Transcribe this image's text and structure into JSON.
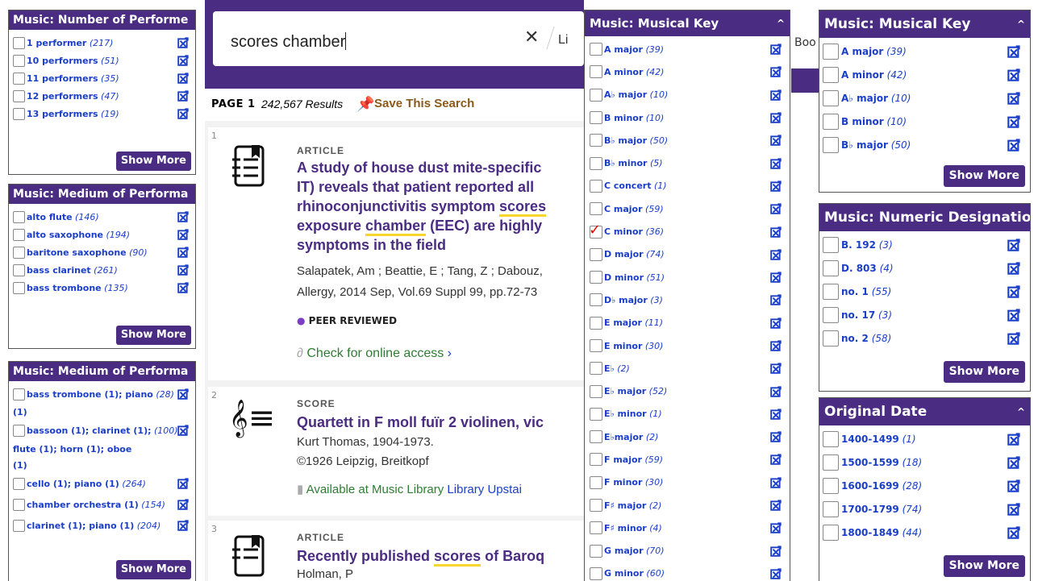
{
  "search": {
    "query": "scores chamber",
    "clear_label": "✕",
    "limit_label_partial": "Li",
    "books_partial": "Boo"
  },
  "results_header": {
    "page_label": "PAGE 1",
    "count": "242,567 Results",
    "save_label": "Save This Search"
  },
  "results": [
    {
      "num": "1",
      "type": "ARTICLE",
      "title_lines": [
        "A study of house dust mite-specific",
        "IT) reveals that patient reported all",
        "rhinoconjunctivitis symptom scores",
        "exposure chamber (EEC) are highly",
        "symptoms in the field"
      ],
      "authors": "Salapatek, Am ; Beattie, E ; Tang, Z ; Dabouz,",
      "source": "Allergy, 2014 Sep, Vol.69 Suppl 99, pp.72-73",
      "peer_reviewed": "PEER REVIEWED",
      "online": "Check for online access"
    },
    {
      "num": "2",
      "type": "SCORE",
      "title": "Quartett in F moll fuïr 2 violinen, vic",
      "author": "Kurt Thomas, 1904-1973.",
      "pub": "©1926 Leipzig, Breitkopf",
      "avail": "Available at Music Library",
      "location": "Library Upstai"
    },
    {
      "num": "3",
      "type": "ARTICLE",
      "title_pre": "Recently published ",
      "title_hl": "scores",
      "title_post": " of Baroq",
      "author": "Holman, P"
    }
  ],
  "facets": {
    "performers": {
      "title": "Music: Number of Performe",
      "items": [
        {
          "label": "1 performer",
          "count": "(217)"
        },
        {
          "label": "10 performers",
          "count": "(51)"
        },
        {
          "label": "11 performers",
          "count": "(35)"
        },
        {
          "label": "12 performers",
          "count": "(47)"
        },
        {
          "label": "13 performers",
          "count": "(19)"
        }
      ],
      "show_more": "Show More"
    },
    "medium1": {
      "title": "Music: Medium of Performa",
      "items": [
        {
          "label": "alto flute",
          "count": "(146)"
        },
        {
          "label": "alto saxophone",
          "count": "(194)"
        },
        {
          "label": "baritone saxophone",
          "count": "(90)"
        },
        {
          "label": "bass clarinet",
          "count": "(261)"
        },
        {
          "label": "bass trombone",
          "count": "(135)"
        }
      ],
      "show_more": "Show More"
    },
    "medium2": {
      "title": "Music: Medium of Performa",
      "items": [
        {
          "label": "bass trombone (1); piano",
          "count": "(28)",
          "cont": "(1)"
        },
        {
          "label": "bassoon (1); clarinet (1);",
          "count": "(100)",
          "cont": "flute (1); horn (1); oboe",
          "cont2": "(1)"
        },
        {
          "label": "cello (1); piano (1)",
          "count": "(264)"
        },
        {
          "label": "chamber orchestra (1)",
          "count": "(154)"
        },
        {
          "label": "clarinet (1); piano (1)",
          "count": "(204)"
        }
      ],
      "show_more": "Show More"
    },
    "key_full": {
      "title": "Music: Musical Key",
      "caret": "^",
      "items": [
        {
          "label": "A major",
          "count": "(39)"
        },
        {
          "label": "A minor",
          "count": "(42)"
        },
        {
          "label": "A♭ major",
          "count": "(10)"
        },
        {
          "label": "B minor",
          "count": "(10)"
        },
        {
          "label": "B♭ major",
          "count": "(50)"
        },
        {
          "label": "B♭ minor",
          "count": "(5)"
        },
        {
          "label": "C concert",
          "count": "(1)"
        },
        {
          "label": "C major",
          "count": "(59)"
        },
        {
          "label": "C minor",
          "count": "(36)",
          "checked": true
        },
        {
          "label": "D major",
          "count": "(74)"
        },
        {
          "label": "D minor",
          "count": "(51)"
        },
        {
          "label": "D♭ major",
          "count": "(3)"
        },
        {
          "label": "E major",
          "count": "(11)"
        },
        {
          "label": "E minor",
          "count": "(30)"
        },
        {
          "label": "E♭",
          "count": "(2)"
        },
        {
          "label": "E♭ major",
          "count": "(52)"
        },
        {
          "label": "E♭ minor",
          "count": "(1)"
        },
        {
          "label": "E♭major",
          "count": "(2)"
        },
        {
          "label": "F major",
          "count": "(59)"
        },
        {
          "label": "F minor",
          "count": "(30)"
        },
        {
          "label": "F♯ major",
          "count": "(2)"
        },
        {
          "label": "F♯ minor",
          "count": "(4)"
        },
        {
          "label": "G major",
          "count": "(70)"
        },
        {
          "label": "G minor",
          "count": "(60)"
        }
      ]
    },
    "key_short": {
      "title": "Music: Musical Key",
      "caret": "^",
      "items": [
        {
          "label": "A major",
          "count": "(39)"
        },
        {
          "label": "A minor",
          "count": "(42)"
        },
        {
          "label": "A♭ major",
          "count": "(10)"
        },
        {
          "label": "B minor",
          "count": "(10)"
        },
        {
          "label": "B♭ major",
          "count": "(50)"
        }
      ],
      "show_more": "Show More"
    },
    "numeric": {
      "title": "Music: Numeric Designation",
      "items": [
        {
          "label": "B. 192",
          "count": "(3)"
        },
        {
          "label": "D. 803",
          "count": "(4)"
        },
        {
          "label": "no. 1",
          "count": "(55)"
        },
        {
          "label": "no. 17",
          "count": "(3)"
        },
        {
          "label": "no. 2",
          "count": "(58)"
        }
      ],
      "show_more": "Show More"
    },
    "date": {
      "title": "Original Date",
      "caret": "^",
      "items": [
        {
          "label": "1400-1499",
          "count": "(1)"
        },
        {
          "label": "1500-1599",
          "count": "(18)"
        },
        {
          "label": "1600-1699",
          "count": "(28)"
        },
        {
          "label": "1700-1799",
          "count": "(74)"
        },
        {
          "label": "1800-1849",
          "count": "(44)"
        }
      ],
      "show_more": "Show More"
    }
  },
  "colors": {
    "brand": "#4b2c83",
    "link": "#1a3ec8",
    "highlight": "#f6d62a",
    "available": "#2e7d32",
    "save": "#8a5a1a"
  }
}
